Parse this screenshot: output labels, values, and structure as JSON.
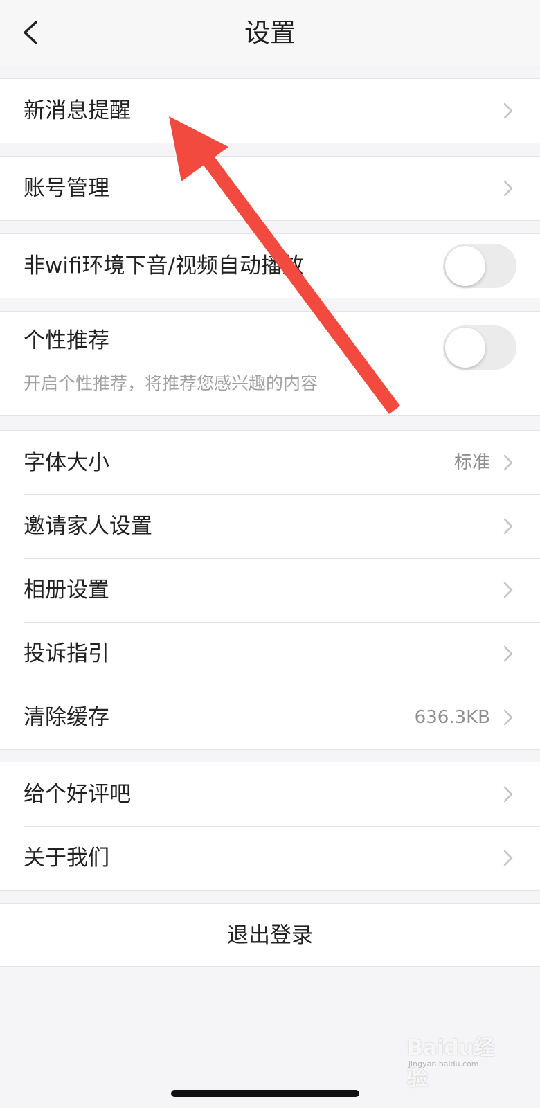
{
  "header": {
    "title": "设置",
    "back_icon": "chevron-left-icon"
  },
  "groups": [
    {
      "items": [
        {
          "label": "新消息提醒"
        }
      ]
    },
    {
      "items": [
        {
          "label": "账号管理"
        }
      ]
    },
    {
      "items": [
        {
          "label": "非wifi环境下音/视频自动播放",
          "toggle_on": false
        }
      ]
    },
    {
      "items": [
        {
          "label": "个性推荐",
          "subtitle": "开启个性推荐，将推荐您感兴趣的内容",
          "toggle_on": false
        }
      ]
    },
    {
      "items": [
        {
          "label": "字体大小",
          "value": "标准"
        },
        {
          "label": "邀请家人设置"
        },
        {
          "label": "相册设置"
        },
        {
          "label": "投诉指引"
        },
        {
          "label": "清除缓存",
          "value": "636.3KB"
        }
      ]
    },
    {
      "items": [
        {
          "label": "给个好评吧"
        },
        {
          "label": "关于我们"
        }
      ]
    }
  ],
  "logout_label": "退出登录",
  "annotation": {
    "color": "#f24a3f",
    "icon": "red-arrow-annotation"
  },
  "watermark": {
    "main": "Baidu经验",
    "sub": "jingyan.baidu.com"
  },
  "colors": {
    "background": "#f5f5f7",
    "toggle_off": "#ebebeb",
    "secondary_text": "#8e8e93"
  }
}
